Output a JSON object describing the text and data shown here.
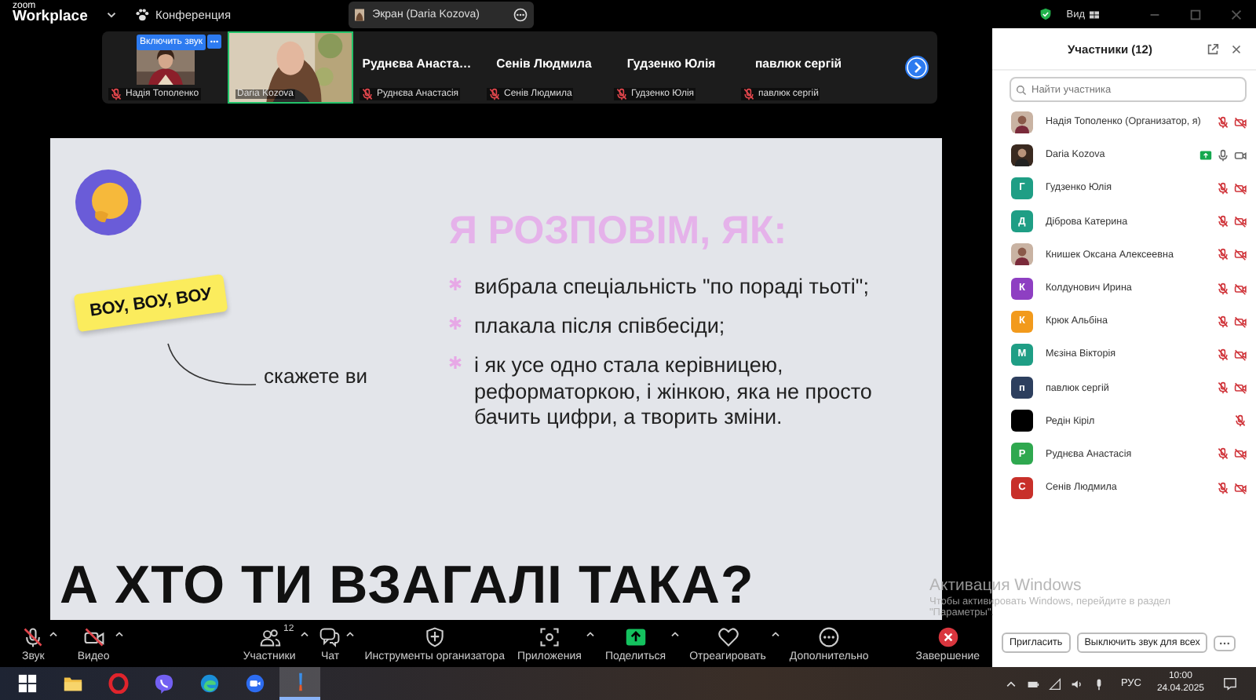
{
  "app": {
    "logo_top": "zoom",
    "logo_bottom": "Workplace",
    "meeting_menu": "Конференция",
    "screen_tab": "Экран (Daria Kozova)",
    "view_menu": "Вид"
  },
  "thumbnails": [
    {
      "kind": "video",
      "name": "Надія Тополенко",
      "muted": true,
      "speaking": false,
      "unmute_button": "Включить звук"
    },
    {
      "kind": "video",
      "name": "Daria Kozova",
      "muted": false,
      "speaking": true
    },
    {
      "kind": "name",
      "display": "Руднєва Анаста…",
      "name": "Руднєва Анастасія",
      "muted": true,
      "speaking": false
    },
    {
      "kind": "name",
      "display": "Сенів Людмила",
      "name": "Сенів Людмила",
      "muted": true,
      "speaking": false
    },
    {
      "kind": "name",
      "display": "Гудзенко Юлія",
      "name": "Гудзенко Юлія",
      "muted": true,
      "speaking": false
    },
    {
      "kind": "name",
      "display": "павлюк сергій",
      "name": "павлюк сергій",
      "muted": true,
      "speaking": false
    }
  ],
  "slide": {
    "sticker": "ВОУ, ВОУ, ВОУ",
    "caption": "скажете ви",
    "heading": "Я РОЗПОВІМ, ЯК:",
    "bullets": [
      "вибрала спеціальність \"по пораді тьоті\";",
      "плакала після співбесіди;",
      "і як усе одно стала керівницею, реформаторкою, і жінкою, яка не просто бачить цифри, а творить зміни."
    ],
    "bottom_heading": "А ХТО ТИ ВЗАГАЛІ ТАКА?"
  },
  "toolbar": [
    {
      "kind": "audio",
      "label": "Звук",
      "off": true,
      "menu": true
    },
    {
      "kind": "video",
      "label": "Видео",
      "off": true,
      "menu": true
    },
    {
      "kind": "participants",
      "label": "Участники",
      "count": "12",
      "menu": true
    },
    {
      "kind": "chat",
      "label": "Чат",
      "menu": true
    },
    {
      "kind": "host_tools",
      "label": "Инструменты организатора",
      "menu": false
    },
    {
      "kind": "apps",
      "label": "Приложения",
      "menu": true
    },
    {
      "kind": "share",
      "label": "Поделиться",
      "menu": true
    },
    {
      "kind": "react",
      "label": "Отреагировать",
      "menu": true
    },
    {
      "kind": "more",
      "label": "Дополнительно",
      "menu": false
    }
  ],
  "end_button": "Завершение",
  "panel": {
    "title": "Участники (12)",
    "search": {
      "placeholder": "Найти участника"
    },
    "participants": [
      {
        "name": "Надія Тополенко (Организатор, я)",
        "muted": true,
        "video_off": true,
        "sharing": false
      },
      {
        "name": "Daria Kozova",
        "muted": false,
        "video_off": false,
        "sharing": true
      },
      {
        "name": "Гудзенко Юлія",
        "kind": "letter",
        "letter": "Г",
        "color": "#1f9e85",
        "muted": true,
        "video_off": true,
        "sharing": false
      },
      {
        "name": "Діброва Катерина",
        "kind": "letter",
        "letter": "Д",
        "color": "#1f9e85",
        "muted": true,
        "video_off": true,
        "sharing": false
      },
      {
        "name": "Книшек Оксана Алексеевна",
        "muted": true,
        "video_off": true,
        "sharing": false
      },
      {
        "name": "Колдунович Ирина",
        "kind": "letter",
        "letter": "К",
        "color": "#8e3fc2",
        "muted": true,
        "video_off": true,
        "sharing": false
      },
      {
        "name": "Крюк Альбіна",
        "kind": "letter",
        "letter": "К",
        "color": "#f29a1c",
        "muted": true,
        "video_off": true,
        "sharing": false
      },
      {
        "name": "Мєзіна Вікторія",
        "kind": "letter",
        "letter": "М",
        "color": "#1f9e85",
        "muted": true,
        "video_off": true,
        "sharing": false
      },
      {
        "name": "павлюк сергій",
        "kind": "letter",
        "letter": "п",
        "color": "#2d3f5e",
        "muted": true,
        "video_off": true,
        "sharing": false
      },
      {
        "name": "Редін Кіріл",
        "kind": "audio_only",
        "color": "#000000",
        "muted": true,
        "sharing": false
      },
      {
        "name": "Руднєва Анастасія",
        "kind": "letter",
        "letter": "Р",
        "color": "#2fa84f",
        "muted": true,
        "video_off": true,
        "sharing": false
      },
      {
        "name": "Сенів Людмила",
        "kind": "letter",
        "letter": "С",
        "color": "#c8302a",
        "muted": true,
        "video_off": true,
        "sharing": false
      }
    ],
    "buttons": [
      "Пригласить",
      "Выключить звук для всех"
    ]
  },
  "watermark": {
    "title": "Активация Windows",
    "line1": "Чтобы активировать Windows, перейдите в раздел",
    "line2": "\"Параметры\"."
  },
  "taskbar": {
    "apps": [
      {
        "kind": "windows",
        "selected": false
      },
      {
        "kind": "explorer",
        "selected": false
      },
      {
        "kind": "opera",
        "selected": false
      },
      {
        "kind": "viber",
        "selected": false
      },
      {
        "kind": "edge",
        "selected": false
      },
      {
        "kind": "zoom",
        "selected": false
      },
      {
        "kind": "app",
        "selected": true
      }
    ],
    "language": "РУС",
    "time": "10:00",
    "date": "24.04.2025"
  }
}
